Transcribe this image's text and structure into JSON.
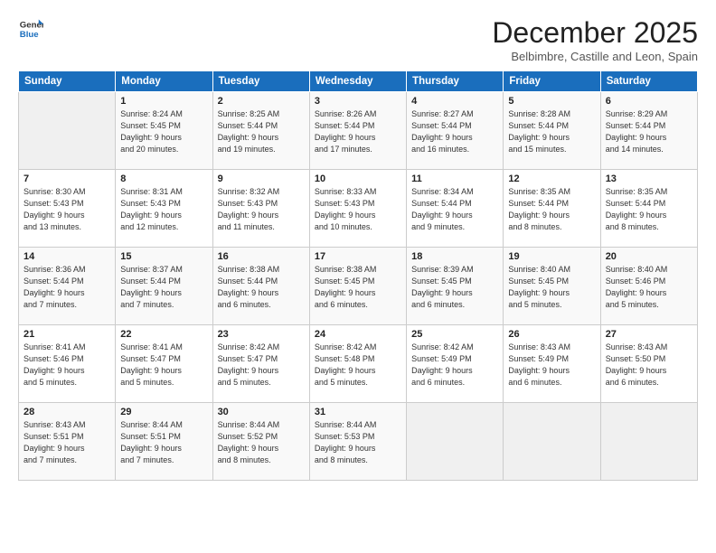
{
  "logo": {
    "line1": "General",
    "line2": "Blue"
  },
  "title": "December 2025",
  "subtitle": "Belbimbre, Castille and Leon, Spain",
  "days_header": [
    "Sunday",
    "Monday",
    "Tuesday",
    "Wednesday",
    "Thursday",
    "Friday",
    "Saturday"
  ],
  "weeks": [
    [
      {
        "num": "",
        "info": ""
      },
      {
        "num": "1",
        "info": "Sunrise: 8:24 AM\nSunset: 5:45 PM\nDaylight: 9 hours\nand 20 minutes."
      },
      {
        "num": "2",
        "info": "Sunrise: 8:25 AM\nSunset: 5:44 PM\nDaylight: 9 hours\nand 19 minutes."
      },
      {
        "num": "3",
        "info": "Sunrise: 8:26 AM\nSunset: 5:44 PM\nDaylight: 9 hours\nand 17 minutes."
      },
      {
        "num": "4",
        "info": "Sunrise: 8:27 AM\nSunset: 5:44 PM\nDaylight: 9 hours\nand 16 minutes."
      },
      {
        "num": "5",
        "info": "Sunrise: 8:28 AM\nSunset: 5:44 PM\nDaylight: 9 hours\nand 15 minutes."
      },
      {
        "num": "6",
        "info": "Sunrise: 8:29 AM\nSunset: 5:44 PM\nDaylight: 9 hours\nand 14 minutes."
      }
    ],
    [
      {
        "num": "7",
        "info": "Sunrise: 8:30 AM\nSunset: 5:43 PM\nDaylight: 9 hours\nand 13 minutes."
      },
      {
        "num": "8",
        "info": "Sunrise: 8:31 AM\nSunset: 5:43 PM\nDaylight: 9 hours\nand 12 minutes."
      },
      {
        "num": "9",
        "info": "Sunrise: 8:32 AM\nSunset: 5:43 PM\nDaylight: 9 hours\nand 11 minutes."
      },
      {
        "num": "10",
        "info": "Sunrise: 8:33 AM\nSunset: 5:43 PM\nDaylight: 9 hours\nand 10 minutes."
      },
      {
        "num": "11",
        "info": "Sunrise: 8:34 AM\nSunset: 5:44 PM\nDaylight: 9 hours\nand 9 minutes."
      },
      {
        "num": "12",
        "info": "Sunrise: 8:35 AM\nSunset: 5:44 PM\nDaylight: 9 hours\nand 8 minutes."
      },
      {
        "num": "13",
        "info": "Sunrise: 8:35 AM\nSunset: 5:44 PM\nDaylight: 9 hours\nand 8 minutes."
      }
    ],
    [
      {
        "num": "14",
        "info": "Sunrise: 8:36 AM\nSunset: 5:44 PM\nDaylight: 9 hours\nand 7 minutes."
      },
      {
        "num": "15",
        "info": "Sunrise: 8:37 AM\nSunset: 5:44 PM\nDaylight: 9 hours\nand 7 minutes."
      },
      {
        "num": "16",
        "info": "Sunrise: 8:38 AM\nSunset: 5:44 PM\nDaylight: 9 hours\nand 6 minutes."
      },
      {
        "num": "17",
        "info": "Sunrise: 8:38 AM\nSunset: 5:45 PM\nDaylight: 9 hours\nand 6 minutes."
      },
      {
        "num": "18",
        "info": "Sunrise: 8:39 AM\nSunset: 5:45 PM\nDaylight: 9 hours\nand 6 minutes."
      },
      {
        "num": "19",
        "info": "Sunrise: 8:40 AM\nSunset: 5:45 PM\nDaylight: 9 hours\nand 5 minutes."
      },
      {
        "num": "20",
        "info": "Sunrise: 8:40 AM\nSunset: 5:46 PM\nDaylight: 9 hours\nand 5 minutes."
      }
    ],
    [
      {
        "num": "21",
        "info": "Sunrise: 8:41 AM\nSunset: 5:46 PM\nDaylight: 9 hours\nand 5 minutes."
      },
      {
        "num": "22",
        "info": "Sunrise: 8:41 AM\nSunset: 5:47 PM\nDaylight: 9 hours\nand 5 minutes."
      },
      {
        "num": "23",
        "info": "Sunrise: 8:42 AM\nSunset: 5:47 PM\nDaylight: 9 hours\nand 5 minutes."
      },
      {
        "num": "24",
        "info": "Sunrise: 8:42 AM\nSunset: 5:48 PM\nDaylight: 9 hours\nand 5 minutes."
      },
      {
        "num": "25",
        "info": "Sunrise: 8:42 AM\nSunset: 5:49 PM\nDaylight: 9 hours\nand 6 minutes."
      },
      {
        "num": "26",
        "info": "Sunrise: 8:43 AM\nSunset: 5:49 PM\nDaylight: 9 hours\nand 6 minutes."
      },
      {
        "num": "27",
        "info": "Sunrise: 8:43 AM\nSunset: 5:50 PM\nDaylight: 9 hours\nand 6 minutes."
      }
    ],
    [
      {
        "num": "28",
        "info": "Sunrise: 8:43 AM\nSunset: 5:51 PM\nDaylight: 9 hours\nand 7 minutes."
      },
      {
        "num": "29",
        "info": "Sunrise: 8:44 AM\nSunset: 5:51 PM\nDaylight: 9 hours\nand 7 minutes."
      },
      {
        "num": "30",
        "info": "Sunrise: 8:44 AM\nSunset: 5:52 PM\nDaylight: 9 hours\nand 8 minutes."
      },
      {
        "num": "31",
        "info": "Sunrise: 8:44 AM\nSunset: 5:53 PM\nDaylight: 9 hours\nand 8 minutes."
      },
      {
        "num": "",
        "info": ""
      },
      {
        "num": "",
        "info": ""
      },
      {
        "num": "",
        "info": ""
      }
    ]
  ]
}
